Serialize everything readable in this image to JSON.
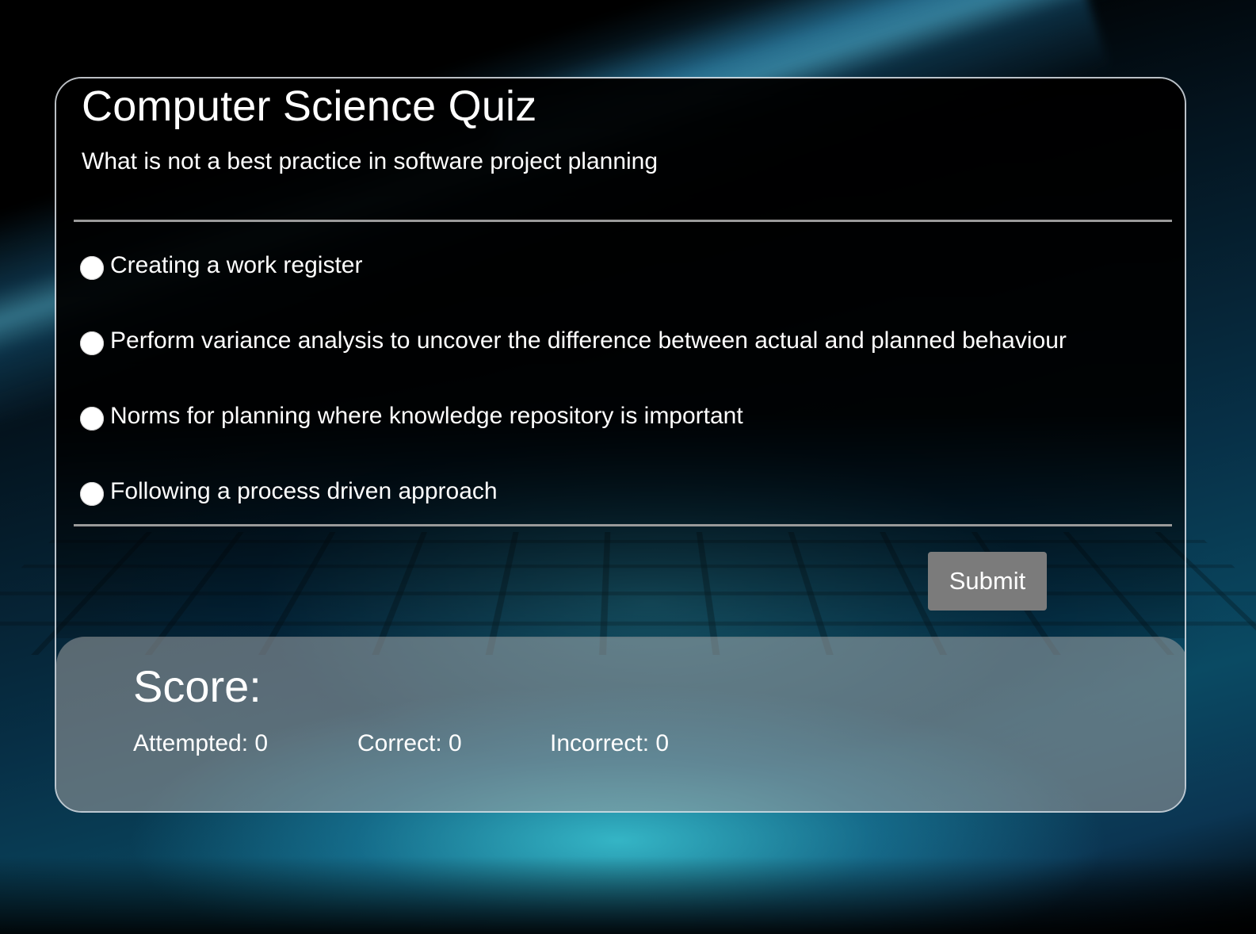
{
  "quiz": {
    "title": "Computer Science Quiz",
    "question": "What is not a best practice in software project planning",
    "options": [
      {
        "label": "Creating a work register"
      },
      {
        "label": "Perform variance analysis to uncover the difference between actual and planned behaviour"
      },
      {
        "label": "Norms for planning where knowledge repository is important"
      },
      {
        "label": "Following a process driven approach"
      }
    ],
    "submit_label": "Submit"
  },
  "score": {
    "title": "Score:",
    "attempted": "Attempted: 0",
    "correct": "Correct: 0",
    "incorrect": "Incorrect: 0"
  },
  "colors": {
    "submit_button": "#7b7b7b",
    "card_border": "#dce1e6",
    "score_panel": "#a0a0a0"
  }
}
